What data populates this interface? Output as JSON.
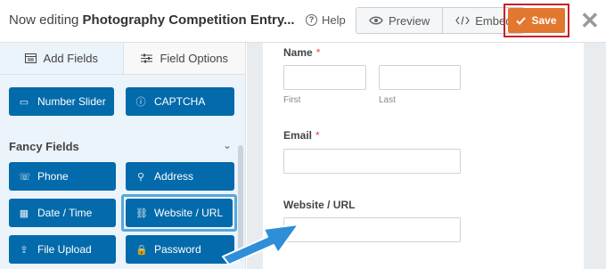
{
  "header": {
    "title_prefix": "Now editing ",
    "form_name": "Photography Competition Entry...",
    "help_label": "Help",
    "preview_label": "Preview",
    "embed_label": "Embed",
    "save_label": "Save",
    "close_glyph": "✕"
  },
  "sidebar": {
    "tabs": [
      {
        "label": "Add Fields",
        "icon": "list-icon",
        "active": true
      },
      {
        "label": "Field Options",
        "icon": "sliders-icon",
        "active": false
      }
    ],
    "top_buttons": [
      {
        "label": "Number Slider",
        "icon": "slider-icon"
      },
      {
        "label": "CAPTCHA",
        "icon": "question-icon"
      }
    ],
    "section": {
      "title": "Fancy Fields",
      "chevron": "⌄"
    },
    "fancy_fields": [
      {
        "label": "Phone",
        "icon": "phone-icon"
      },
      {
        "label": "Address",
        "icon": "map-pin-icon"
      },
      {
        "label": "Date / Time",
        "icon": "calendar-icon"
      },
      {
        "label": "Website / URL",
        "icon": "link-icon",
        "highlighted": true
      },
      {
        "label": "File Upload",
        "icon": "upload-icon"
      },
      {
        "label": "Password",
        "icon": "lock-icon"
      }
    ]
  },
  "form": {
    "name_label": "Name",
    "required_mark": "*",
    "first_sublabel": "First",
    "last_sublabel": "Last",
    "email_label": "Email",
    "website_label": "Website / URL"
  },
  "colors": {
    "accent_blue": "#036aab",
    "save_orange": "#e27730",
    "highlight_red": "#c8202a",
    "highlight_blue": "#55a8dc",
    "arrow_blue": "#2e8fd8"
  }
}
